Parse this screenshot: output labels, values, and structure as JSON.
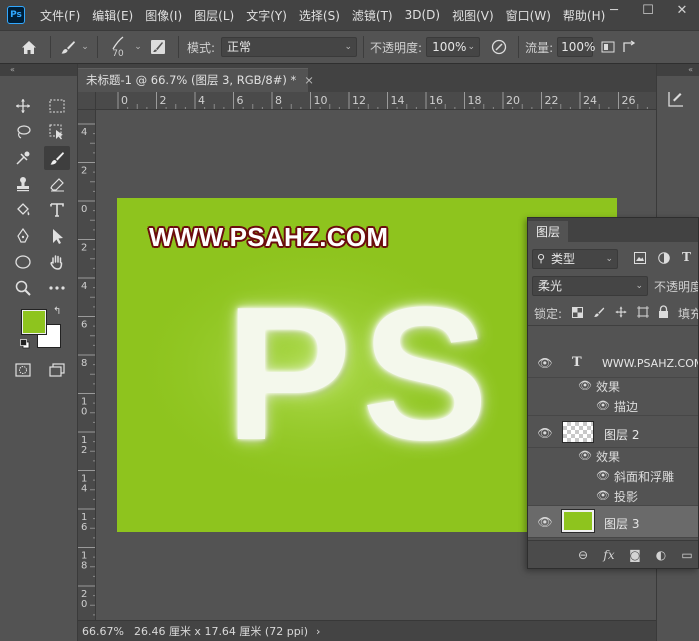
{
  "app": {
    "logo": "Ps"
  },
  "menu": {
    "items": [
      "文件(F)",
      "编辑(E)",
      "图像(I)",
      "图层(L)",
      "文字(Y)",
      "选择(S)",
      "滤镜(T)",
      "3D(D)",
      "视图(V)",
      "窗口(W)",
      "帮助(H)"
    ]
  },
  "window_controls": {
    "minimize": "─",
    "maximize": "☐",
    "close": "✕"
  },
  "options_bar": {
    "brush_size": "70",
    "mode_label": "模式:",
    "mode_value": "正常",
    "opacity_label": "不透明度:",
    "opacity_value": "100%",
    "flow_label": "流量:",
    "flow_value": "100%"
  },
  "toolbar": {
    "tools": [
      "move-tool",
      "marquee-tool",
      "lasso-tool",
      "object-select-tool",
      "eyedropper-tool",
      "brush-tool",
      "stamp-tool",
      "eraser-tool",
      "paint-bucket-tool",
      "type-tool",
      "pen-tool",
      "path-select-tool",
      "ellipse-tool",
      "hand-tool",
      "zoom-tool",
      "more-tools"
    ],
    "foreground_color": "#8ec41e",
    "background_color": "#ffffff"
  },
  "document": {
    "tab_title": "未标题-1 @ 66.7% (图层 3, RGB/8#) *",
    "close_glyph": "×",
    "ruler_h": [
      "0",
      "2",
      "4",
      "6",
      "8",
      "10",
      "12",
      "14",
      "16",
      "18",
      "20",
      "22",
      "24",
      "26"
    ],
    "ruler_v": [
      "4",
      "2",
      "0",
      "2",
      "4",
      "6",
      "8",
      "1\n0",
      "1\n2",
      "1\n4",
      "1\n6",
      "1\n8",
      "2\n0"
    ]
  },
  "canvas": {
    "background_color": "#8ec41e",
    "watermark": "WWW.PSAHZ.COM",
    "fur_text": "PS"
  },
  "status_bar": {
    "zoom": "66.67%",
    "doc_info": "26.46 厘米 x 17.64 厘米 (72 ppi)",
    "arrow": "›"
  },
  "layers_panel": {
    "tab": "图层",
    "filter_label": "类型",
    "blend_mode": "柔光",
    "opacity_label": "不透明度",
    "lock_label": "锁定:",
    "fill_label": "填充",
    "layers": [
      {
        "name": "WWW.PSAHZ.COM",
        "kind": "text",
        "effects_label": "效果",
        "effects": [
          "描边"
        ]
      },
      {
        "name": "图层 2",
        "kind": "pixel",
        "effects_label": "效果",
        "effects": [
          "斜面和浮雕",
          "投影"
        ]
      },
      {
        "name": "图层 3",
        "kind": "pixel",
        "selected": true
      }
    ]
  }
}
